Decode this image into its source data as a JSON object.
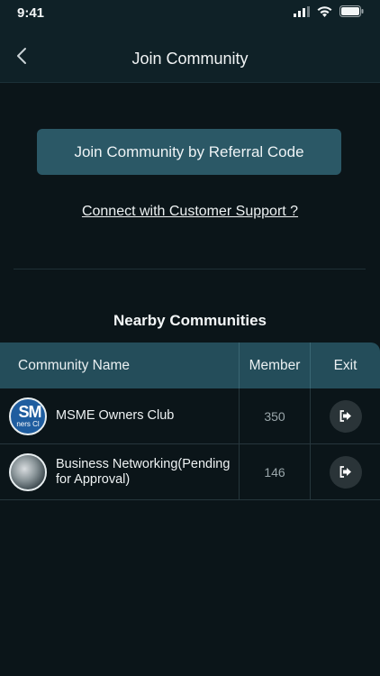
{
  "status_bar": {
    "time": "9:41"
  },
  "header": {
    "title": "Join Community"
  },
  "actions": {
    "referral_button": "Join Community by Referral Code",
    "support_link": "Connect with Customer Support ?"
  },
  "section": {
    "title": "Nearby Communities"
  },
  "table": {
    "columns": [
      "Community Name",
      "Member",
      "Exit"
    ],
    "rows": [
      {
        "name": "MSME Owners Club",
        "members": "350",
        "avatar_text_1": "SM",
        "avatar_text_2": "ners Cl"
      },
      {
        "name": "Business Networking(Pending for Approval)",
        "members": "146"
      }
    ]
  },
  "colors": {
    "background": "#0b1519",
    "header_bg": "#0f2127",
    "accent": "#2b5866",
    "table_header": "#244d5a"
  },
  "icons": [
    "signal-icon",
    "wifi-icon",
    "battery-icon",
    "back-chevron-icon",
    "exit-icon"
  ]
}
